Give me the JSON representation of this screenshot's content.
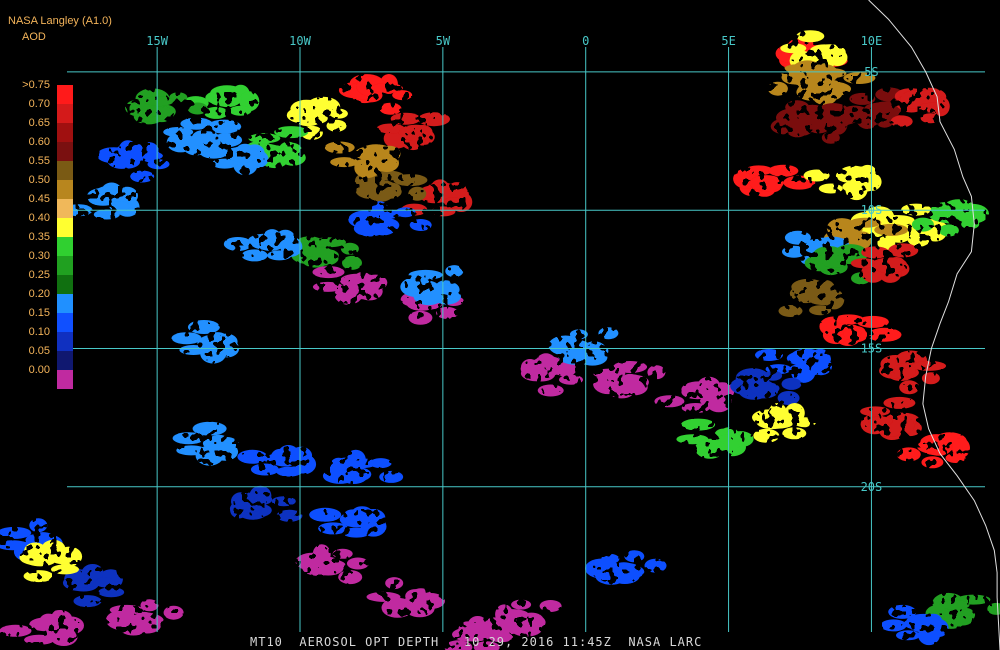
{
  "header": {
    "title": "NASA Langley (A1.0)",
    "subtitle": "AOD"
  },
  "colors": {
    "header_text": "#f4b45a",
    "grid": "#48c8c8",
    "coast": "#e0e0e0",
    "footer_text": "#d8d8d8"
  },
  "legend": {
    "labels": [
      ">0.75",
      "0.70",
      "0.65",
      "0.60",
      "0.55",
      "0.50",
      "0.45",
      "0.40",
      "0.35",
      "0.30",
      "0.25",
      "0.20",
      "0.15",
      "0.10",
      "0.05",
      "0.00"
    ],
    "colors": [
      "#ff1a1a",
      "#d41a1a",
      "#a01010",
      "#7a1010",
      "#7a5a14",
      "#b8861e",
      "#f0b85a",
      "#ffff30",
      "#30d030",
      "#20a020",
      "#107010",
      "#2090ff",
      "#1050ff",
      "#1030c0",
      "#101870",
      "#c02aa0"
    ]
  },
  "map": {
    "longitude_labels": [
      "15W",
      "10W",
      "5W",
      "0",
      "5E",
      "10E"
    ],
    "latitude_labels": [
      "5S",
      "10S",
      "15S",
      "20S"
    ]
  },
  "footer": {
    "text": "MT10  AEROSOL OPT DEPTH   10 29, 2016 11:45Z  NASA LARC"
  },
  "map_data": {
    "lon_range": [
      -20.5,
      14.5
    ],
    "lat_range": [
      -25.9,
      -2.4
    ],
    "grid_lon": [
      -15,
      -10,
      -5,
      0,
      5,
      10
    ],
    "grid_lat": [
      -5,
      -10,
      -15,
      -20
    ],
    "coastline": [
      [
        9.9,
        -2.4
      ],
      [
        10.6,
        -3.1
      ],
      [
        11.4,
        -4.1
      ],
      [
        11.9,
        -5.0
      ],
      [
        12.3,
        -5.9
      ],
      [
        12.4,
        -6.8
      ],
      [
        12.9,
        -7.8
      ],
      [
        13.2,
        -8.8
      ],
      [
        13.5,
        -9.5
      ],
      [
        13.6,
        -10.5
      ],
      [
        13.5,
        -11.5
      ],
      [
        13.0,
        -12.3
      ],
      [
        12.7,
        -13.3
      ],
      [
        12.4,
        -14.1
      ],
      [
        12.1,
        -15.0
      ],
      [
        11.9,
        -16.0
      ],
      [
        11.8,
        -17.0
      ],
      [
        12.0,
        -17.9
      ],
      [
        12.4,
        -18.8
      ],
      [
        13.0,
        -19.6
      ],
      [
        13.6,
        -20.5
      ],
      [
        14.0,
        -21.4
      ],
      [
        14.3,
        -22.3
      ],
      [
        14.4,
        -23.1
      ],
      [
        14.4,
        -24.0
      ],
      [
        14.5,
        -25.9
      ]
    ],
    "aerosol_clusters": [
      {
        "lon": 7.6,
        "lat": -4.5,
        "aod": 0.8
      },
      {
        "lon": 8.3,
        "lat": -4.3,
        "aod": 0.4
      },
      {
        "lon": 7.6,
        "lat": -5.2,
        "aod": 0.48
      },
      {
        "lon": 8.6,
        "lat": -5.6,
        "aod": 0.48
      },
      {
        "lon": 8.4,
        "lat": -6.6,
        "aod": 0.58
      },
      {
        "lon": 7.6,
        "lat": -7.0,
        "aod": 0.62
      },
      {
        "lon": 10.3,
        "lat": -6.4,
        "aod": 0.6
      },
      {
        "lon": 11.5,
        "lat": -6.2,
        "aod": 0.7
      },
      {
        "lon": 6.3,
        "lat": -9.0,
        "aod": 0.75
      },
      {
        "lon": 9.3,
        "lat": -8.8,
        "aod": 0.42
      },
      {
        "lon": 10.2,
        "lat": -10.6,
        "aod": 0.42
      },
      {
        "lon": 11.8,
        "lat": -10.6,
        "aod": 0.4
      },
      {
        "lon": 12.8,
        "lat": -10.2,
        "aod": 0.36
      },
      {
        "lon": 9.6,
        "lat": -11.0,
        "aod": 0.48
      },
      {
        "lon": 8.3,
        "lat": -11.4,
        "aod": 0.18
      },
      {
        "lon": 8.8,
        "lat": -12.0,
        "aod": 0.32
      },
      {
        "lon": 10.6,
        "lat": -12.0,
        "aod": 0.7
      },
      {
        "lon": 7.8,
        "lat": -13.1,
        "aod": 0.55
      },
      {
        "lon": 9.3,
        "lat": -14.4,
        "aod": 0.75
      },
      {
        "lon": 7.6,
        "lat": -15.4,
        "aod": 0.14
      },
      {
        "lon": 11.2,
        "lat": -15.8,
        "aod": 0.7
      },
      {
        "lon": 11.0,
        "lat": -17.6,
        "aod": 0.7
      },
      {
        "lon": 12.4,
        "lat": -18.6,
        "aod": 0.78
      },
      {
        "lon": 13.2,
        "lat": -24.6,
        "aod": 0.28
      },
      {
        "lon": 11.8,
        "lat": -25.0,
        "aod": 0.15
      },
      {
        "lon": -7.5,
        "lat": -5.8,
        "aod": 0.75
      },
      {
        "lon": -6.0,
        "lat": -7.2,
        "aod": 0.72
      },
      {
        "lon": -5.2,
        "lat": -9.5,
        "aod": 0.7
      },
      {
        "lon": -7.0,
        "lat": -9.2,
        "aod": 0.56
      },
      {
        "lon": -7.5,
        "lat": -8.0,
        "aod": 0.5
      },
      {
        "lon": -9.5,
        "lat": -6.6,
        "aod": 0.4
      },
      {
        "lon": -10.5,
        "lat": -7.8,
        "aod": 0.36
      },
      {
        "lon": -12.5,
        "lat": -6.0,
        "aod": 0.36
      },
      {
        "lon": -14.8,
        "lat": -6.4,
        "aod": 0.3
      },
      {
        "lon": -12.0,
        "lat": -8.0,
        "aod": 0.2
      },
      {
        "lon": -16.0,
        "lat": -8.2,
        "aod": 0.16
      },
      {
        "lon": -13.5,
        "lat": -7.4,
        "aod": 0.2
      },
      {
        "lon": -16.8,
        "lat": -9.6,
        "aod": 0.2
      },
      {
        "lon": -9.2,
        "lat": -11.6,
        "aod": 0.3
      },
      {
        "lon": -8.0,
        "lat": -12.6,
        "aod": 0.02
      },
      {
        "lon": -5.5,
        "lat": -13.3,
        "aod": 0.02
      },
      {
        "lon": -5.0,
        "lat": -12.8,
        "aod": 0.18
      },
      {
        "lon": -11.0,
        "lat": -11.2,
        "aod": 0.18
      },
      {
        "lon": -7.0,
        "lat": -10.5,
        "aod": 0.16
      },
      {
        "lon": -13.0,
        "lat": -14.8,
        "aod": 0.18
      },
      {
        "lon": -1.5,
        "lat": -15.9,
        "aod": 0.02
      },
      {
        "lon": 1.5,
        "lat": -16.2,
        "aod": 0.02
      },
      {
        "lon": 4.0,
        "lat": -16.6,
        "aod": 0.02
      },
      {
        "lon": 6.2,
        "lat": -16.4,
        "aod": 0.12
      },
      {
        "lon": 4.8,
        "lat": -18.2,
        "aod": 0.35
      },
      {
        "lon": 6.8,
        "lat": -17.6,
        "aod": 0.42
      },
      {
        "lon": 0.2,
        "lat": -15.0,
        "aod": 0.2
      },
      {
        "lon": -10.5,
        "lat": -19.0,
        "aod": 0.16
      },
      {
        "lon": -8.0,
        "lat": -19.5,
        "aod": 0.14
      },
      {
        "lon": -13.0,
        "lat": -18.5,
        "aod": 0.2
      },
      {
        "lon": -17.5,
        "lat": -23.5,
        "aod": 0.12
      },
      {
        "lon": -15.5,
        "lat": -24.8,
        "aod": 0.02
      },
      {
        "lon": -18.8,
        "lat": -25.0,
        "aod": 0.02
      },
      {
        "lon": -9.0,
        "lat": -22.8,
        "aod": 0.02
      },
      {
        "lon": -6.0,
        "lat": -24.0,
        "aod": 0.02
      },
      {
        "lon": -3.8,
        "lat": -25.3,
        "aod": 0.02
      },
      {
        "lon": -2.0,
        "lat": -24.8,
        "aod": 0.02
      },
      {
        "lon": -8.0,
        "lat": -21.2,
        "aod": 0.14
      },
      {
        "lon": -11.5,
        "lat": -20.8,
        "aod": 0.1
      },
      {
        "lon": -19.2,
        "lat": -22.0,
        "aod": 0.14
      },
      {
        "lon": -19.0,
        "lat": -22.6,
        "aod": 0.4
      },
      {
        "lon": 1.3,
        "lat": -23.0,
        "aod": 0.16
      }
    ]
  }
}
